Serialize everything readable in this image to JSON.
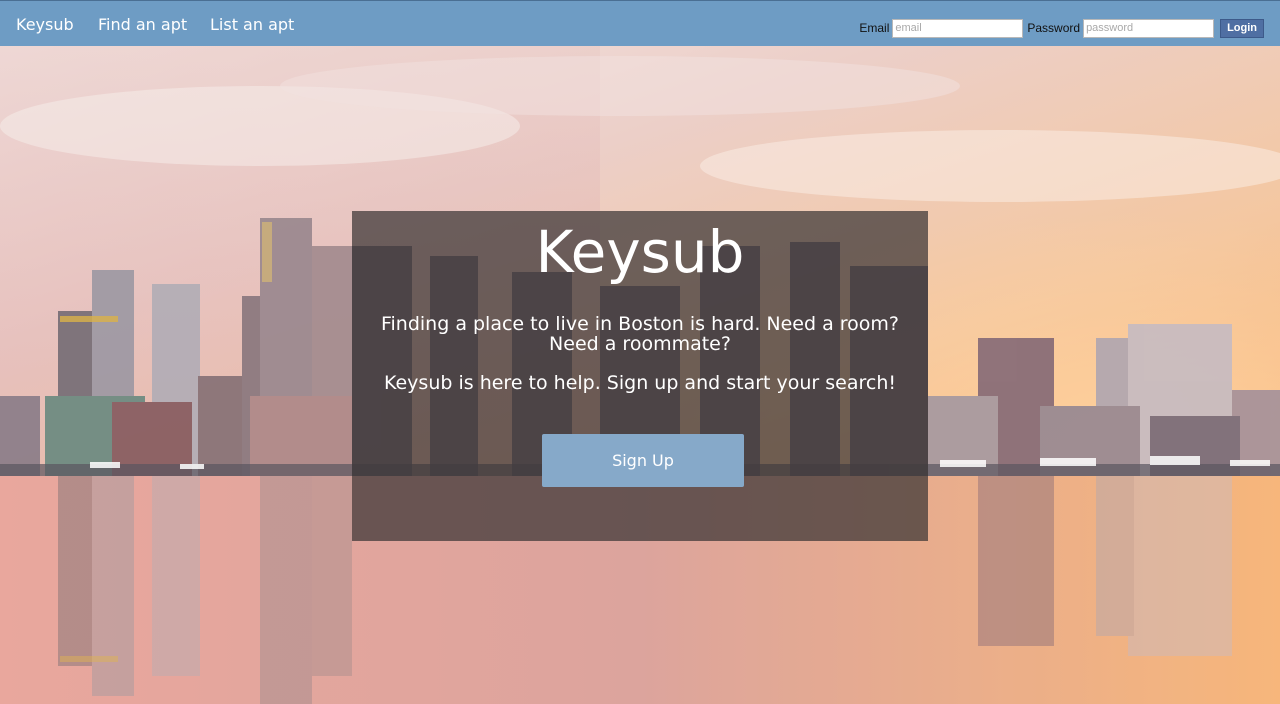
{
  "nav": {
    "brand": "Keysub",
    "find": "Find an apt",
    "list": "List an apt"
  },
  "login": {
    "email_label": "Email",
    "email_placeholder": "email",
    "password_label": "Password",
    "password_placeholder": "password",
    "button": "Login"
  },
  "hero": {
    "title": "Keysub",
    "text1": "Finding a place to live in Boston is hard. Need a room? Need a roommate?",
    "text2": "Keysub is here to help. Sign up and start your search!",
    "signup_button": "Sign Up"
  },
  "colors": {
    "navbar": "#6e9cc4",
    "panel": "#3a3434",
    "signup_button": "#86a9c9",
    "login_button": "#4f6fa3"
  }
}
